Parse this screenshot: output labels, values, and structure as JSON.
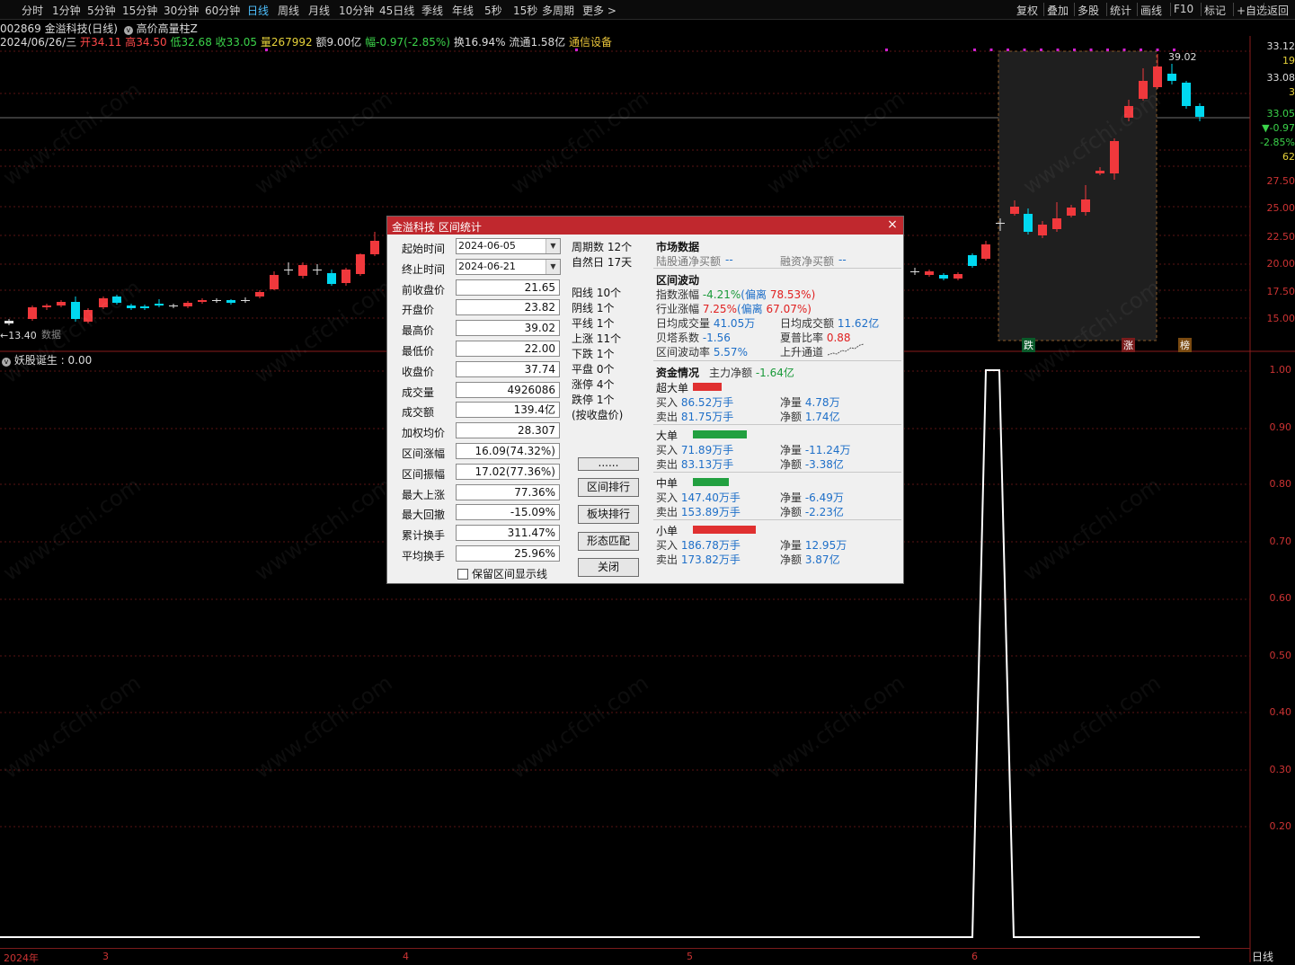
{
  "toolbar": {
    "left": [
      "分时",
      "1分钟",
      "5分钟",
      "15分钟",
      "30分钟",
      "60分钟",
      "日线",
      "周线",
      "月线",
      "10分钟",
      "45日线",
      "季线",
      "年线",
      "5秒",
      "15秒",
      "多周期",
      "更多 >"
    ],
    "active": "日线",
    "right": [
      "复权",
      "叠加",
      "多股",
      "统计",
      "画线",
      "F10",
      "标记",
      "+自选",
      "返回"
    ]
  },
  "stock": {
    "code_name": "002869 金溢科技(日线)",
    "indicator_name": "高价高量柱Z",
    "date": "2024/06/26/三",
    "open_label": "开",
    "open": "34.11",
    "high_label": "高",
    "high": "34.50",
    "low_label": "低",
    "low": "32.68",
    "close_label": "收",
    "close": "33.05",
    "vol_label": "量",
    "vol": "267992",
    "amount_label": "额",
    "amount": "9.00亿",
    "chg_label": "幅",
    "chg": "-0.97(-2.85%)",
    "turnover_label": "换",
    "turnover": "16.94%",
    "float_label": "流通",
    "float": "1.58亿",
    "sector": "通信设备"
  },
  "main_chart": {
    "max_label": "39.02",
    "min_label": "←13.40",
    "min_note": "数据",
    "range_tags": [
      "跌",
      "涨",
      "榜"
    ]
  },
  "right_axis": {
    "price": [
      "33.12",
      "19",
      "33.08",
      "3",
      "33.05",
      "▼-0.97",
      "-2.85%",
      "62",
      "27.50",
      "25.00",
      "22.50",
      "20.00",
      "17.50",
      "15.00"
    ],
    "indicator": [
      "1.00",
      "0.90",
      "0.80",
      "0.70",
      "0.60",
      "0.50",
      "0.40",
      "0.30",
      "0.20"
    ]
  },
  "indicator": {
    "label": "妖股诞生 : 0.00"
  },
  "bottom_axis": {
    "labels": [
      "2024年",
      "3",
      "4",
      "5",
      "6"
    ],
    "period": "日线"
  },
  "watermark": "www.cfchi.com",
  "dialog": {
    "title": "金溢科技 区间统计",
    "close_icon": "×",
    "fields": [
      {
        "label": "起始时间",
        "value": "2024-06-05",
        "combo": true
      },
      {
        "label": "终止时间",
        "value": "2024-06-21",
        "combo": true
      },
      {
        "label": "前收盘价",
        "value": "21.65"
      },
      {
        "label": "开盘价",
        "value": "23.82"
      },
      {
        "label": "最高价",
        "value": "39.02"
      },
      {
        "label": "最低价",
        "value": "22.00"
      },
      {
        "label": "收盘价",
        "value": "37.74"
      },
      {
        "label": "成交量",
        "value": "4926086"
      },
      {
        "label": "成交额",
        "value": "139.4亿"
      },
      {
        "label": "加权均价",
        "value": "28.307"
      },
      {
        "label": "区间涨幅",
        "value": "16.09(74.32%)"
      },
      {
        "label": "区间振幅",
        "value": "17.02(77.36%)"
      },
      {
        "label": "最大上涨",
        "value": "77.36%"
      },
      {
        "label": "最大回撤",
        "value": "-15.09%"
      },
      {
        "label": "累计换手",
        "value": "311.47%"
      },
      {
        "label": "平均换手",
        "value": "25.96%"
      }
    ],
    "checkbox_label": "保留区间显示线",
    "middle": [
      "周期数 12个",
      "自然日 17天",
      "",
      "阳线 10个",
      "阴线 1个",
      "平线 1个",
      "上涨 11个",
      "下跌 1个",
      "平盘 0个",
      "涨停 4个",
      "跌停 1个",
      "(按收盘价)"
    ],
    "buttons": [
      "......",
      "区间排行",
      "板块排行",
      "形态匹配",
      "关闭"
    ],
    "market": {
      "title": "市场数据",
      "hk_label": "陆股通净买额",
      "hk_value": "--",
      "margin_label": "融资净买额",
      "margin_value": "--"
    },
    "volatility": {
      "title": "区间波动",
      "index_label": "指数涨幅",
      "index_value": "-4.21%",
      "index_dev_label": "(偏离",
      "index_dev": "78.53%)",
      "industry_label": "行业涨幅",
      "industry_value": "7.25%",
      "industry_dev_label": "(偏离",
      "industry_dev": "67.07%)",
      "avg_vol_label": "日均成交量",
      "avg_vol": "41.05万",
      "avg_amt_label": "日均成交额",
      "avg_amt": "11.62亿",
      "beta_label": "贝塔系数",
      "beta": "-1.56",
      "sharpe_label": "夏普比率",
      "sharpe": "0.88",
      "vola_label": "区间波动率",
      "vola": "5.57%",
      "channel_label": "上升通道"
    },
    "funds": {
      "title": "资金情况",
      "main_label": "主力净额",
      "main_value": "-1.64亿",
      "groups": [
        {
          "name": "超大单",
          "buy": "86.52万手",
          "sell": "81.75万手",
          "net_qty": "4.78万",
          "net_amt": "1.74亿",
          "bar_color": "#e03030",
          "bar_w": 32
        },
        {
          "name": "大单",
          "buy": "71.89万手",
          "sell": "83.13万手",
          "net_qty": "-11.24万",
          "net_amt": "-3.38亿",
          "bar_color": "#22a040",
          "bar_w": 60
        },
        {
          "name": "中单",
          "buy": "147.40万手",
          "sell": "153.89万手",
          "net_qty": "-6.49万",
          "net_amt": "-2.23亿",
          "bar_color": "#22a040",
          "bar_w": 40
        },
        {
          "name": "小单",
          "buy": "186.78万手",
          "sell": "173.82万手",
          "net_qty": "12.95万",
          "net_amt": "3.87亿",
          "bar_color": "#e03030",
          "bar_w": 70
        }
      ],
      "buy_label": "买入",
      "sell_label": "卖出",
      "net_qty_label": "净量",
      "net_amt_label": "净额"
    }
  }
}
